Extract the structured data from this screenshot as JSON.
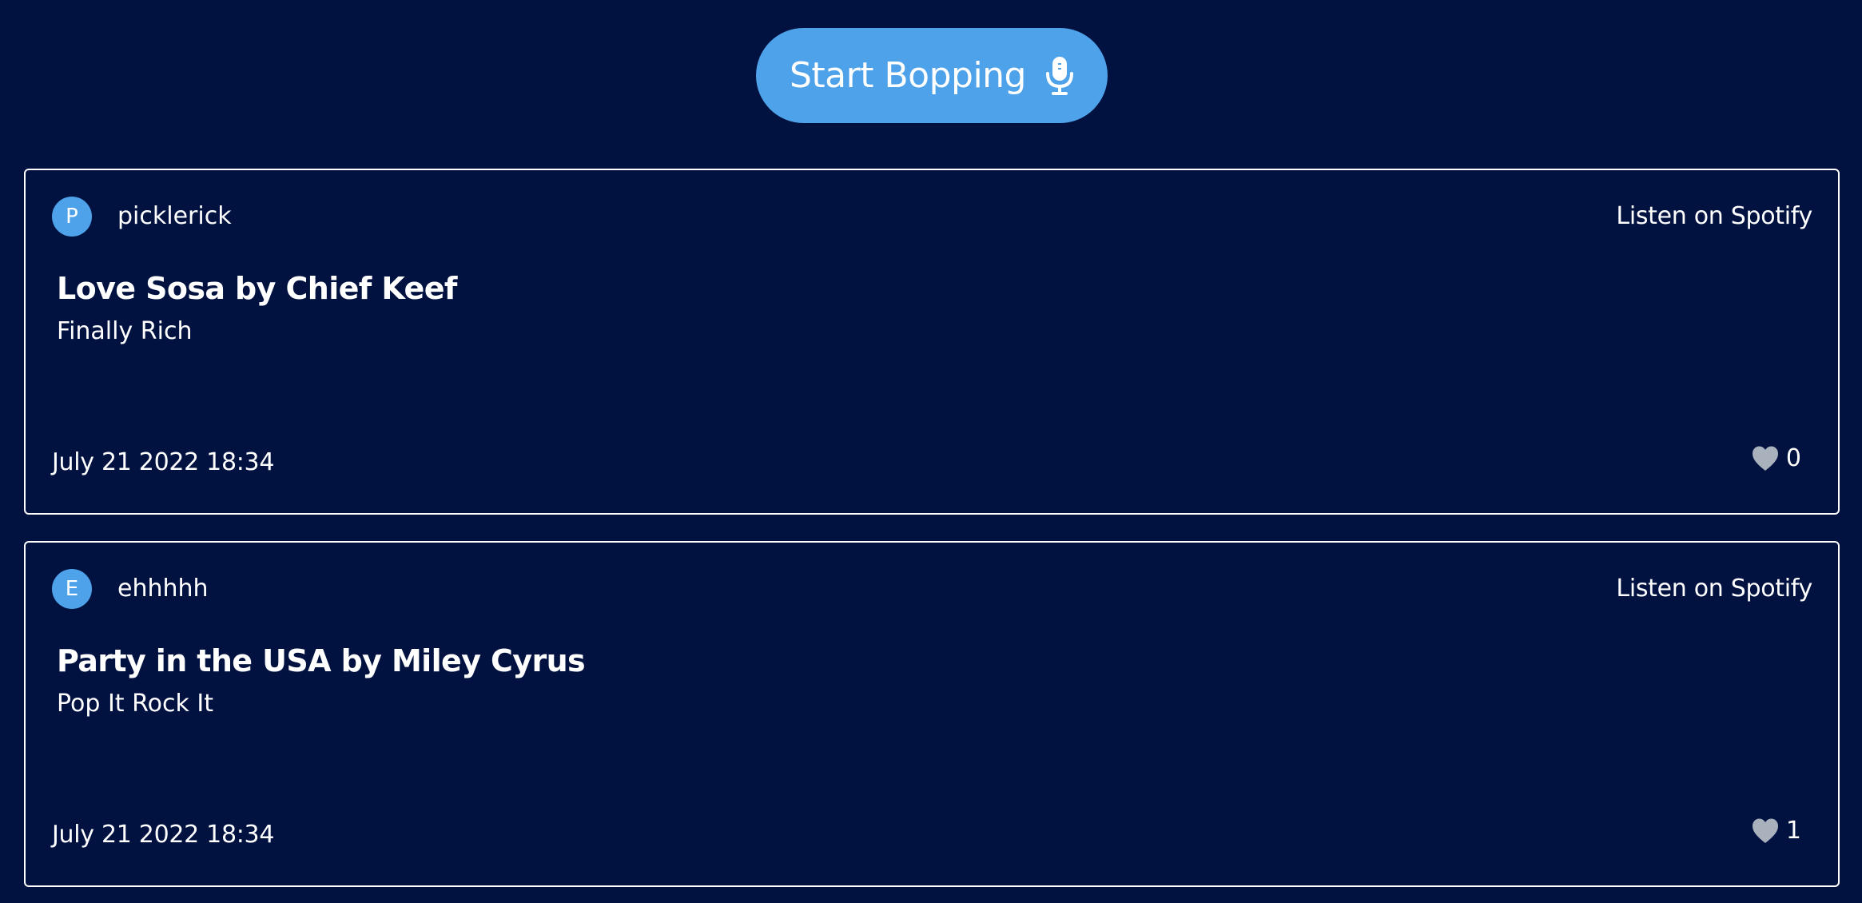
{
  "start_button": {
    "label": "Start Bopping",
    "icon": "microphone-icon"
  },
  "colors": {
    "background": "#011241",
    "accent": "#4ea2ea",
    "heart": "#a9b1bd",
    "border": "#ffffff"
  },
  "posts": [
    {
      "avatar_letter": "P",
      "username": "picklerick",
      "link_label": "Listen on Spotify",
      "song_title": "Love Sosa by Chief Keef",
      "album": "Finally Rich",
      "timestamp": "July 21 2022 18:34",
      "likes": "0",
      "like_icon": "heart-icon"
    },
    {
      "avatar_letter": "E",
      "username": "ehhhhh",
      "link_label": "Listen on Spotify",
      "song_title": "Party in the USA by Miley Cyrus",
      "album": "Pop It Rock It",
      "timestamp": "July 21 2022 18:34",
      "likes": "1",
      "like_icon": "heart-icon"
    }
  ]
}
